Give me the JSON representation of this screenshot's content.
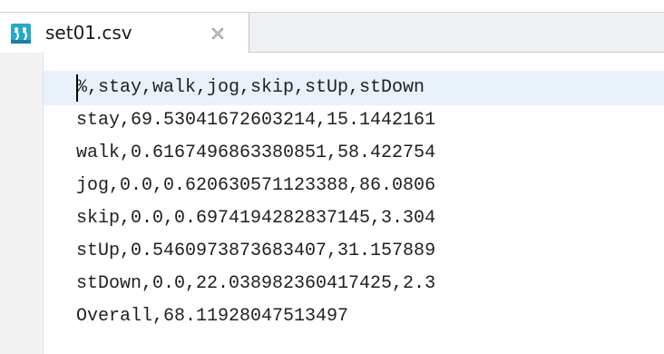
{
  "tab": {
    "title": "set01.csv",
    "icon": "csv-file-icon",
    "close_icon": "close-icon"
  },
  "editor": {
    "lines": [
      "%,stay,walk,jog,skip,stUp,stDown",
      "stay,69.53041672603214,15.1442161",
      "walk,0.6167496863380851,58.422754",
      "jog,0.0,0.620630571123388,86.0806",
      "skip,0.0,0.6974194282837145,3.304",
      "stUp,0.5460973873683407,31.157889",
      "stDown,0.0,22.038982360417425,2.3",
      "Overall,68.11928047513497"
    ]
  },
  "colors": {
    "tabbar_bg": "#eef0f3",
    "current_line_bg": "#e9f2fb",
    "icon_teal": "#2aa7c9"
  }
}
